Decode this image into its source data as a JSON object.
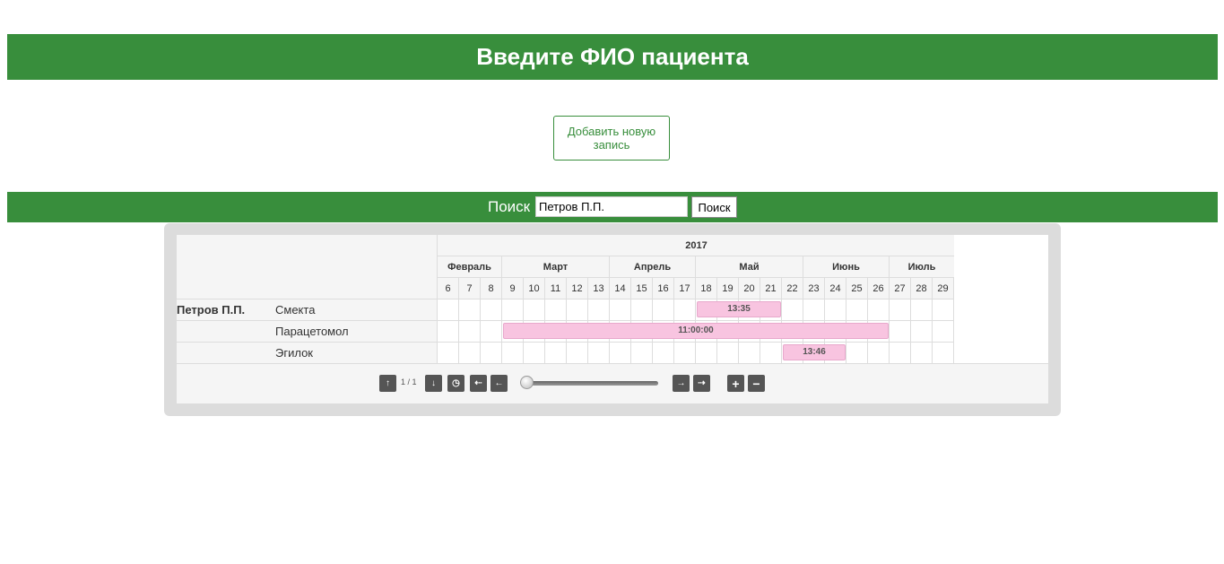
{
  "header": {
    "title": "Введите ФИО пациента"
  },
  "add_button": {
    "label": "Добавить новую запись"
  },
  "search": {
    "label": "Поиск",
    "value": "Петров П.П.",
    "button_label": "Поиск"
  },
  "gantt": {
    "year": "2017",
    "months": [
      "Февраль",
      "Март",
      "Апрель",
      "Май",
      "Июнь",
      "Июль"
    ],
    "weeks": [
      "6",
      "7",
      "8",
      "9",
      "10",
      "11",
      "12",
      "13",
      "14",
      "15",
      "16",
      "17",
      "18",
      "19",
      "20",
      "21",
      "22",
      "23",
      "24",
      "25",
      "26",
      "27",
      "28",
      "29"
    ],
    "rows": [
      {
        "patient": "Петров П.П.",
        "drug": "Смекта",
        "bar_label": "13:35"
      },
      {
        "patient": "",
        "drug": "Парацетомол",
        "bar_label": "11:00:00"
      },
      {
        "patient": "",
        "drug": "Эгилок",
        "bar_label": "13:46"
      }
    ],
    "toolbar": {
      "page_indicator": "1 / 1",
      "icons": [
        "arrow-up-icon",
        "arrow-down-icon",
        "clock-icon",
        "scroll-start-icon",
        "arrow-left-icon",
        "arrow-right-icon",
        "scroll-end-icon",
        "zoom-in-icon",
        "zoom-out-icon"
      ]
    }
  },
  "colors": {
    "primary": "#388e3c",
    "bar": "#f8c4e0"
  }
}
